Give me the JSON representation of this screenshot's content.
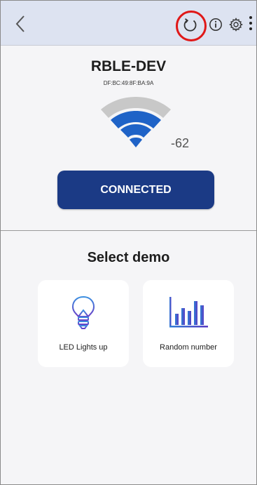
{
  "app_bar": {
    "back_icon": "chevron-left-icon",
    "refresh_icon": "refresh-icon",
    "info_icon": "info-icon",
    "settings_icon": "gear-icon",
    "menu_icon": "more-vertical-icon",
    "highlight_color": "#e01818",
    "bar_color": "#dde3f1"
  },
  "device": {
    "name": "RBLE-DEV",
    "mac": "DF:BC:49:8F:BA:9A",
    "rssi": "-62",
    "signal_icon": "wifi-signal-icon",
    "signal_bars_active": 3,
    "signal_bars_total": 4,
    "signal_active_color": "#1f63c7",
    "signal_inactive_color": "#c8c8c8"
  },
  "connection": {
    "status_label": "CONNECTED",
    "button_color": "#1b3a85"
  },
  "demo_section": {
    "title": "Select demo",
    "cards": [
      {
        "label": "LED Lights up",
        "icon": "light-bulb-icon"
      },
      {
        "label": "Random number",
        "icon": "bar-chart-icon"
      }
    ]
  }
}
